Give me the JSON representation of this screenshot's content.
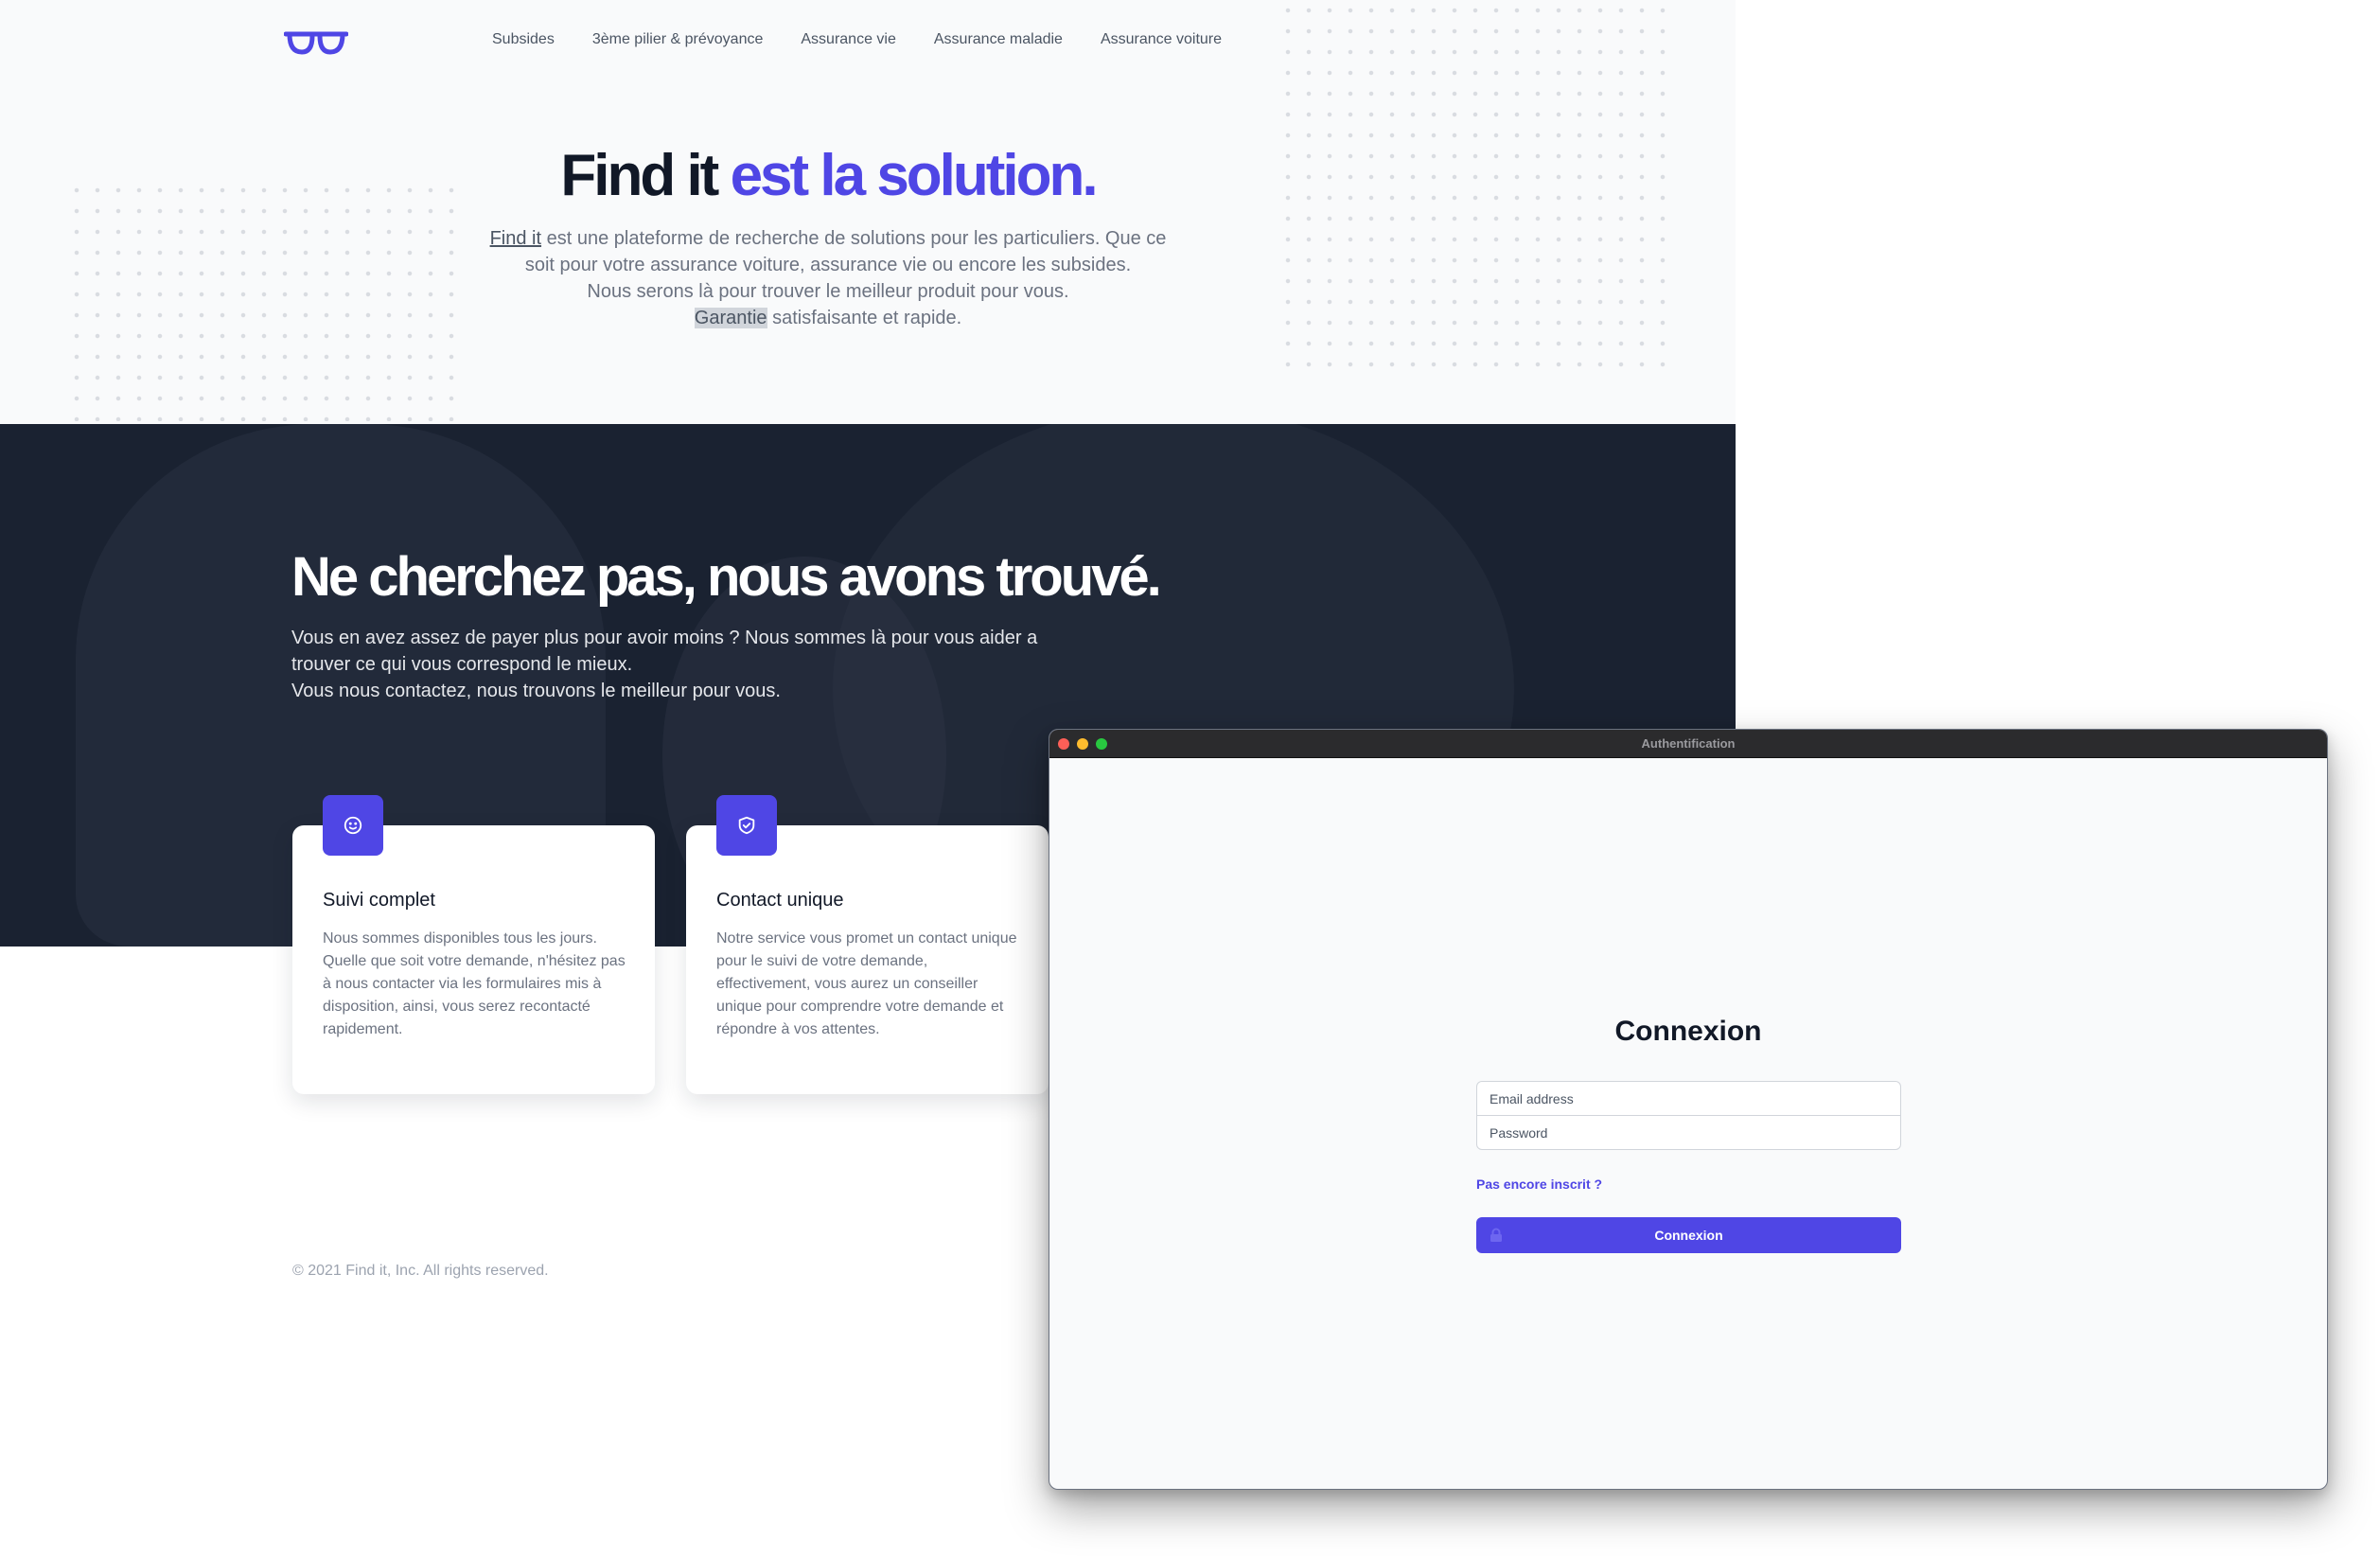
{
  "nav": {
    "items": [
      "Subsides",
      "3ème pilier & prévoyance",
      "Assurance vie",
      "Assurance maladie",
      "Assurance voiture"
    ]
  },
  "hero": {
    "title_main": "Find it",
    "title_accent": "est la solution.",
    "text_link": "Find it",
    "text_line1_rest": " est une plateforme de recherche de solutions pour les particuliers. Que ce soit pour votre assurance voiture, assurance vie ou encore les subsides.",
    "text_line2": "Nous serons là pour trouver le meilleur produit pour vous.",
    "text_highlight": "Garantie",
    "text_line3_rest": " satisfaisante et rapide."
  },
  "section": {
    "title": "Ne cherchez pas, nous avons trouvé.",
    "text_line1": "Vous en avez assez de payer plus pour avoir moins ? Nous sommes là pour vous aider a trouver ce qui vous correspond le mieux.",
    "text_line2": "Vous nous contactez, nous trouvons le meilleur pour vous."
  },
  "cards": [
    {
      "icon": "smile-icon",
      "title": "Suivi complet",
      "text": "Nous sommes disponibles tous les jours. Quelle que soit votre demande, n'hésitez pas à nous contacter via les formulaires mis à disposition, ainsi, vous serez recontacté rapidement."
    },
    {
      "icon": "shield-check-icon",
      "title": "Contact unique",
      "text": "Notre service vous promet un contact unique pour le suivi de votre demande, effectivement, vous aurez un conseiller unique pour comprendre votre demande et répondre à vos attentes."
    }
  ],
  "footer": {
    "copyright": "© 2021 Find it, Inc. All rights reserved."
  },
  "auth_window": {
    "title": "Authentification",
    "heading": "Connexion",
    "email_placeholder": "Email address",
    "password_placeholder": "Password",
    "signup_link": "Pas encore inscrit ?",
    "submit_label": "Connexion"
  },
  "colors": {
    "accent": "#4f46e5",
    "dark_section": "#1a2231",
    "hero_bg": "#f9fafb",
    "heading": "#111827",
    "body_text": "#6b7280"
  }
}
